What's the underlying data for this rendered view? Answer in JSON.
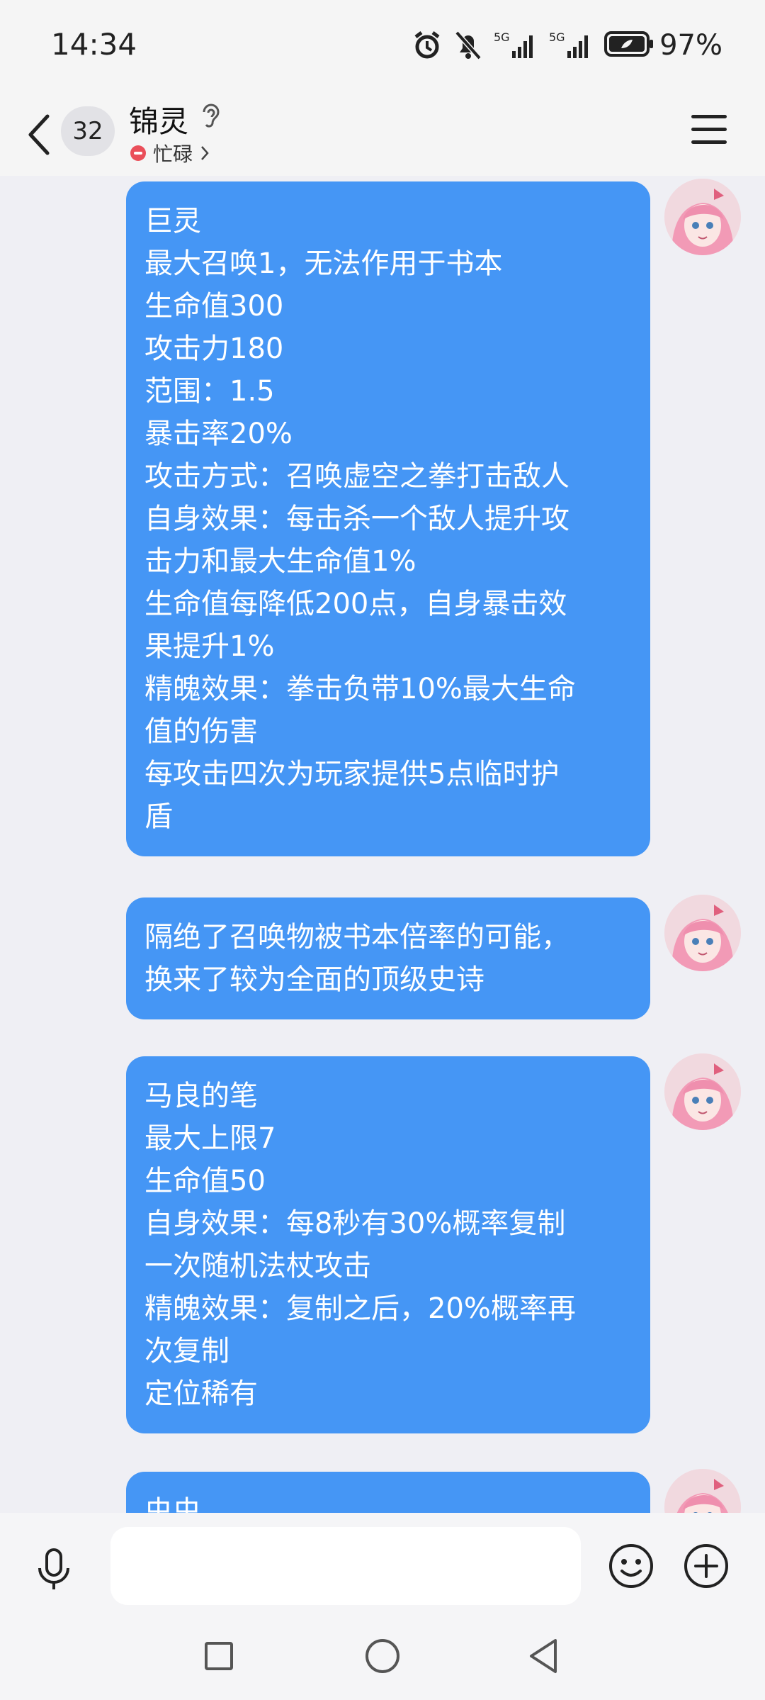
{
  "status_bar": {
    "time": "14:34",
    "battery_percent": "97%",
    "icons": [
      "alarm-icon",
      "mute-bell-icon",
      "signal-5g-icon",
      "signal-5g-icon",
      "battery-icon"
    ]
  },
  "header": {
    "back_icon": "chevron-left-icon",
    "unread_count": "32",
    "contact_name": "锦灵",
    "ear_icon": "ear-icon",
    "status_text": "忙碌",
    "menu_icon": "hamburger-icon"
  },
  "messages": [
    {
      "lines": [
        "巨灵",
        "最大召唤1，无法作用于书本",
        "生命值300",
        "攻击力180",
        "范围：1.5",
        "暴击率20%",
        "攻击方式：召唤虚空之拳打击敌人",
        "自身效果：每击杀一个敌人提升攻",
        "击力和最大生命值1%",
        "生命值每降低200点，自身暴击效",
        "果提升1%",
        "精魄效果：拳击负带10%最大生命",
        "值的伤害",
        "每攻击四次为玩家提供5点临时护",
        "盾"
      ]
    },
    {
      "lines": [
        "隔绝了召唤物被书本倍率的可能，",
        "换来了较为全面的顶级史诗"
      ]
    },
    {
      "lines": [
        "马良的笔",
        "最大上限7",
        "生命值50",
        "自身效果：每8秒有30%概率复制",
        "一次随机法杖攻击",
        "精魄效果：复制之后，20%概率再",
        "次复制",
        "定位稀有"
      ]
    },
    {
      "lines": [
        "虫虫"
      ]
    }
  ],
  "input_bar": {
    "mic_icon": "microphone-icon",
    "placeholder": "",
    "emoji_icon": "smiley-icon",
    "plus_icon": "plus-circle-icon"
  },
  "nav_bar": {
    "icons": [
      "recents-square-icon",
      "home-circle-icon",
      "back-triangle-icon"
    ]
  },
  "colors": {
    "bubble": "#4596f5",
    "background": "#efeff4",
    "busy": "#ea4f5a"
  }
}
